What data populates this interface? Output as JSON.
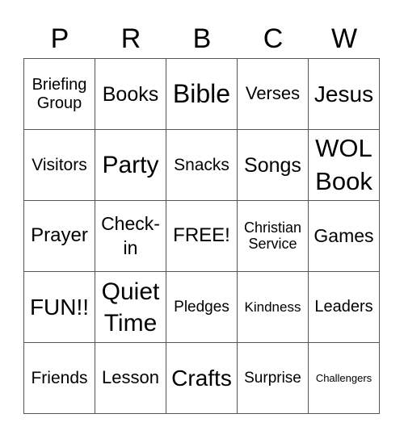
{
  "header": {
    "letters": [
      "P",
      "R",
      "B",
      "C",
      "W"
    ]
  },
  "rows": [
    [
      "Briefing\nGroup",
      "Books",
      "Bible",
      "Verses",
      "Jesus"
    ],
    [
      "Visitors",
      "Party",
      "Snacks",
      "Songs",
      "WOL\nBook"
    ],
    [
      "Prayer",
      "Check-\nin",
      "FREE!",
      "Christian\nService",
      "Games"
    ],
    [
      "FUN!!",
      "Quiet\nTime",
      "Pledges",
      "Kindness",
      "Leaders"
    ],
    [
      "Friends",
      "Lesson",
      "Crafts",
      "Surprise",
      "Challengers"
    ]
  ]
}
